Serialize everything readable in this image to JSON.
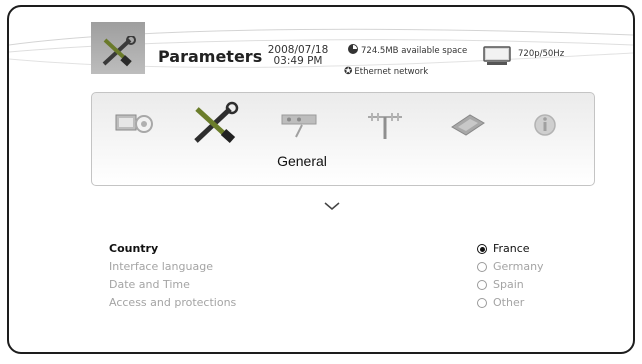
{
  "header": {
    "title": "Parameters",
    "date": "2008/07/18",
    "time": "03:49 PM",
    "disk_space": "724.5MB available space",
    "network": "Ethernet network",
    "resolution": "720p/50Hz",
    "icons": {
      "title": "tools-icon",
      "disk": "disk-space-icon",
      "network": "network-icon",
      "display": "tv-icon"
    }
  },
  "tabs": {
    "selected_label": "General",
    "items": [
      {
        "icon": "tv-settings-icon",
        "selected": false
      },
      {
        "icon": "tools-icon",
        "selected": true
      },
      {
        "icon": "connector-icon",
        "selected": false
      },
      {
        "icon": "antenna-icon",
        "selected": false
      },
      {
        "icon": "chip-icon",
        "selected": false
      },
      {
        "icon": "info-icon",
        "selected": false
      }
    ]
  },
  "settings": {
    "items": [
      {
        "label": "Country",
        "selected": true
      },
      {
        "label": "Interface language",
        "selected": false
      },
      {
        "label": "Date and Time",
        "selected": false
      },
      {
        "label": "Access and protections",
        "selected": false
      }
    ],
    "country_options": [
      {
        "label": "France",
        "selected": true
      },
      {
        "label": "Germany",
        "selected": false
      },
      {
        "label": "Spain",
        "selected": false
      },
      {
        "label": "Other",
        "selected": false
      }
    ]
  },
  "colors": {
    "selected_text": "#111111",
    "unselected_text": "#a4a4a4",
    "frame": "#1d1d1d"
  }
}
